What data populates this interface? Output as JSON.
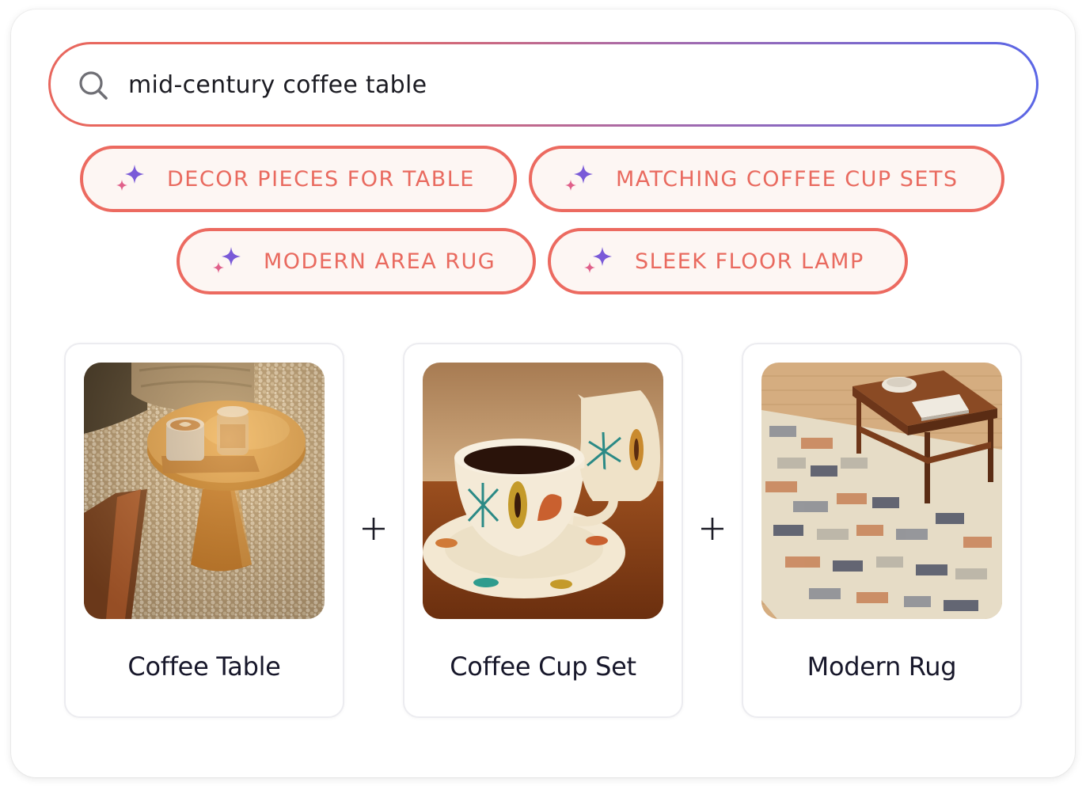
{
  "search": {
    "query": "mid-century coffee table",
    "icon": "search-icon"
  },
  "suggestions": [
    {
      "label": "DECOR PIECES FOR TABLE",
      "icon": "sparkle-icon"
    },
    {
      "label": "MATCHING COFFEE CUP SETS",
      "icon": "sparkle-icon"
    },
    {
      "label": "MODERN AREA RUG",
      "icon": "sparkle-icon"
    },
    {
      "label": "SLEEK FLOOR LAMP",
      "icon": "sparkle-icon"
    }
  ],
  "bundle": [
    {
      "title": "Coffee Table",
      "image": "coffee-table-photo"
    },
    {
      "title": "Coffee Cup Set",
      "image": "coffee-cup-set-photo"
    },
    {
      "title": "Modern Rug",
      "image": "modern-rug-photo"
    }
  ],
  "colors": {
    "chip_border": "#ec6a60",
    "chip_text": "#e96a5f",
    "gradient_start": "#e8675e",
    "gradient_end": "#5a66e6"
  }
}
